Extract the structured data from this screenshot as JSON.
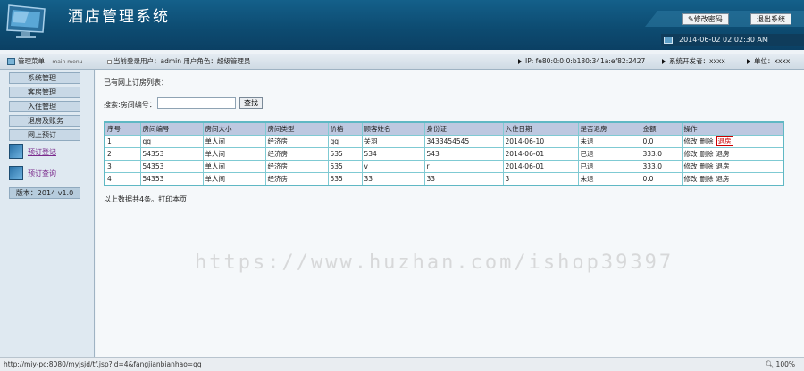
{
  "header": {
    "title": "酒店管理系统",
    "change_password": "修改密码",
    "exit": "退出系统",
    "datetime": "2014-06-02 02:02:30 AM"
  },
  "statusbar": {
    "menu_title": "管理菜单",
    "menu_sub": "main menu",
    "current_user": "当前登录用户：admin  用户角色：超级管理员",
    "ip": "IP: fe80:0:0:0:b180:341a:ef82:2427",
    "developer": "系统开发者：xxxx",
    "unit": "单位：xxxx"
  },
  "sidebar": {
    "items": [
      "系统管理",
      "客房管理",
      "入住管理",
      "退房及账务",
      "网上预订"
    ],
    "links": [
      "预订登记",
      "预订查询"
    ],
    "version": "版本：2014 v1.0"
  },
  "main": {
    "caption": "已有网上订房列表：",
    "search_label": "搜索:房间编号：",
    "search_value": "",
    "search_button": "查找",
    "columns": [
      "序号",
      "房间编号",
      "房间大小",
      "房间类型",
      "价格",
      "顾客姓名",
      "身份证",
      "入住日期",
      "是否退房",
      "金额",
      "操作"
    ],
    "rows": [
      [
        "1",
        "qq",
        "单人间",
        "经济房",
        "qq",
        "关羽",
        "3433454545",
        "2014-06-10",
        "未退",
        "0.0"
      ],
      [
        "2",
        "54353",
        "单人间",
        "经济房",
        "535",
        "534",
        "543",
        "2014-06-01",
        "已退",
        "333.0"
      ],
      [
        "3",
        "54353",
        "单人间",
        "经济房",
        "535",
        "v",
        "r",
        "2014-06-01",
        "已退",
        "333.0"
      ],
      [
        "4",
        "54353",
        "单人间",
        "经济房",
        "535",
        "33",
        "33",
        "3",
        "未退",
        "0.0"
      ]
    ],
    "ops": [
      "修改",
      "删除",
      "退房"
    ],
    "footer_note": "以上数据共4条。打印本页"
  },
  "watermark": "https://www.huzhan.com/ishop39397",
  "browser": {
    "url": "http://miy-pc:8080/myjsjd/tf.jsp?id=4&fangjianbianhao=qq",
    "zoom": "100%"
  },
  "colors": {
    "header_bg": "#0d4c72",
    "table_border": "#5fb8c4",
    "table_header": "#bdc8e0",
    "link": "#7a2a8c",
    "active_op": "#cc0000"
  }
}
